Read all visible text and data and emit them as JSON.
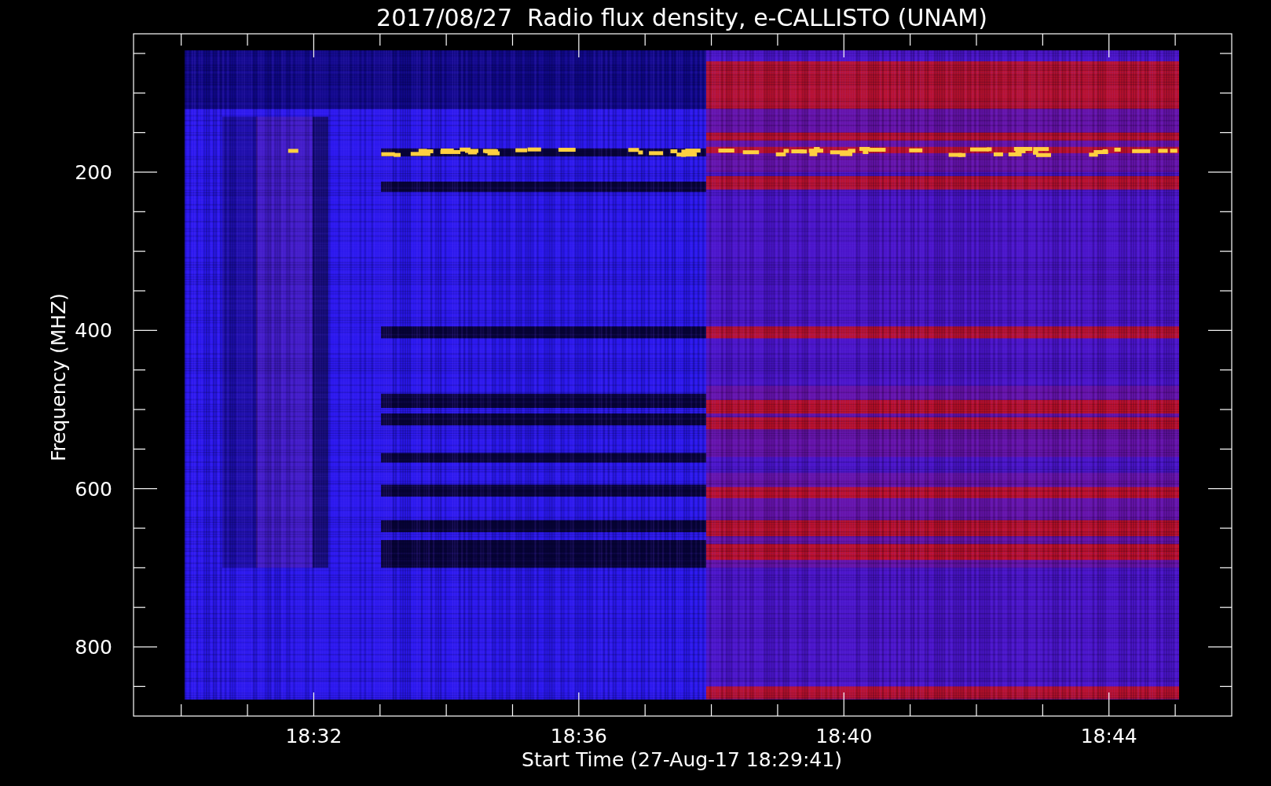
{
  "title": "2017/08/27  Radio flux density, e-CALLISTO (UNAM)",
  "x_axis": {
    "label": "Start Time (27-Aug-17 18:29:41)",
    "ticks": [
      "18:32",
      "18:36",
      "18:40",
      "18:44"
    ]
  },
  "y_axis": {
    "label": "Frequency (MHZ)",
    "ticks": [
      "200",
      "400",
      "600",
      "800"
    ]
  }
}
